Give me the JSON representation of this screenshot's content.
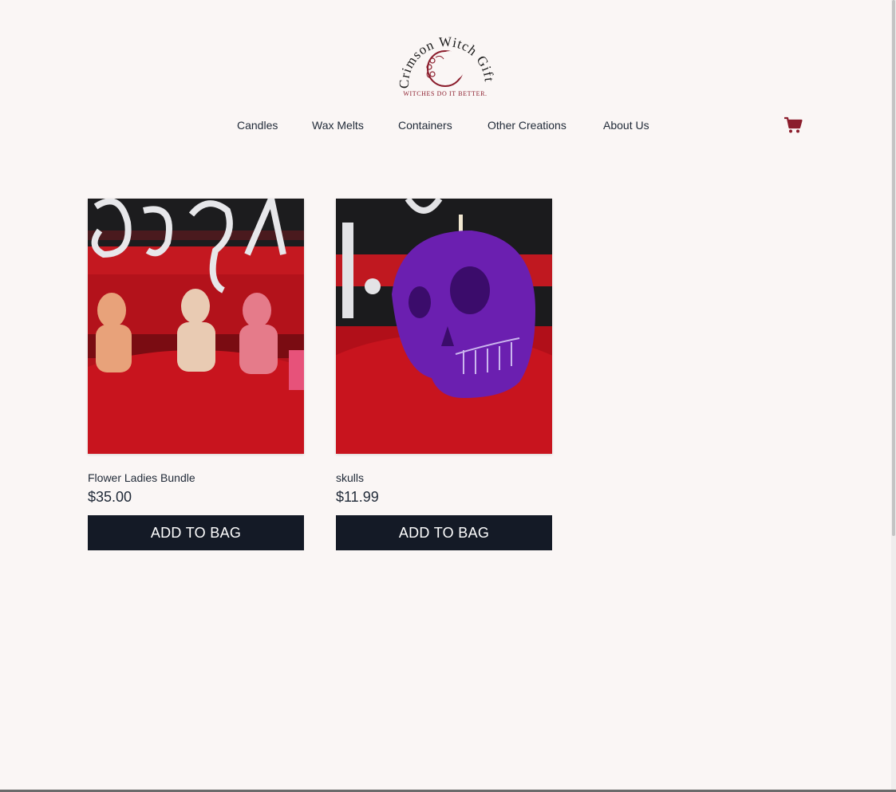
{
  "brand": {
    "name_line": "Crimson Witch Gifts",
    "tagline": "WITCHES DO IT BETTER.",
    "accent_color": "#8b1d2c"
  },
  "nav": {
    "items": [
      {
        "label": "Candles"
      },
      {
        "label": "Wax Melts"
      },
      {
        "label": "Containers"
      },
      {
        "label": "Other Creations"
      },
      {
        "label": "About Us"
      }
    ],
    "cart_icon": "shopping-cart-icon"
  },
  "products": [
    {
      "name": "Flower Ladies Bundle",
      "price": "$35.00",
      "button": "ADD TO BAG"
    },
    {
      "name": "skulls",
      "price": "$11.99",
      "button": "ADD TO BAG"
    }
  ],
  "colors": {
    "background": "#faf6f5",
    "button": "#141a26",
    "text": "#1f2937"
  }
}
